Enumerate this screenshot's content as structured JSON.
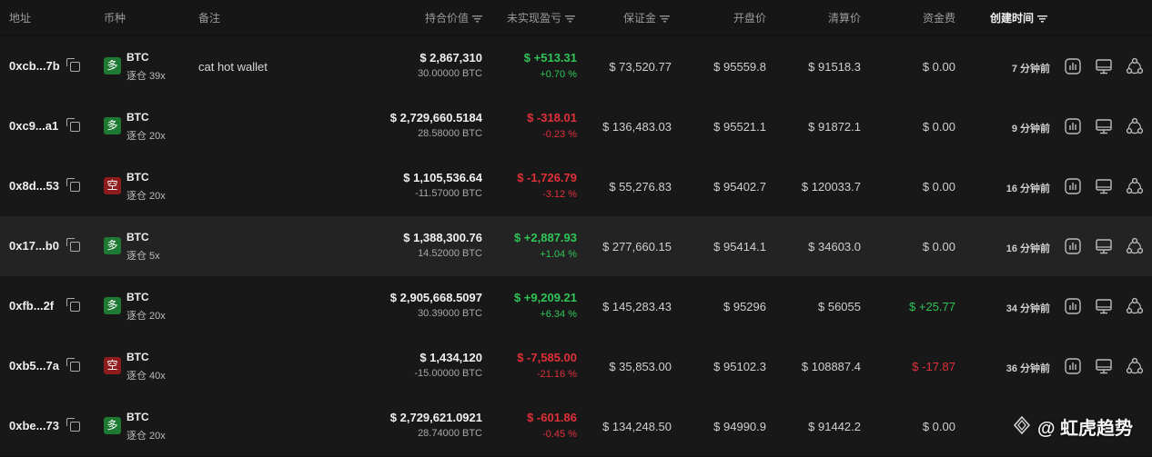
{
  "columns": {
    "address": "地址",
    "coin": "币种",
    "note": "备注",
    "position_value": "持合价值",
    "unrealized_pnl": "未实现盈亏",
    "margin": "保证金",
    "open_price": "开盘价",
    "liq_price": "清算价",
    "funding": "资金费",
    "created": "创建时间"
  },
  "colors": {
    "up": "#2fc558",
    "down": "#e0303a",
    "long_badge": "#1e7a32",
    "short_badge": "#8e1c1c"
  },
  "icons": [
    "copy-icon",
    "chart-icon",
    "monitor-icon",
    "share-icon",
    "filter-icon"
  ],
  "rows": [
    {
      "address": "0xcb...7b",
      "side": "多",
      "coin": "BTC",
      "leverage": "逐仓 39x",
      "note": "cat hot wallet",
      "value": "$ 2,867,310",
      "qty": "30.00000 BTC",
      "pnl": "$ +513.31",
      "pnl_pct": "+0.70 %",
      "margin": "$ 73,520.77",
      "open": "$ 95559.8",
      "liq": "$ 91518.3",
      "funding": "$ 0.00",
      "time": "7 分钟前"
    },
    {
      "address": "0xc9...a1",
      "side": "多",
      "coin": "BTC",
      "leverage": "逐仓 20x",
      "note": "",
      "value": "$ 2,729,660.5184",
      "qty": "28.58000 BTC",
      "pnl": "$ -318.01",
      "pnl_pct": "-0.23 %",
      "margin": "$ 136,483.03",
      "open": "$ 95521.1",
      "liq": "$ 91872.1",
      "funding": "$ 0.00",
      "time": "9 分钟前"
    },
    {
      "address": "0x8d...53",
      "side": "空",
      "coin": "BTC",
      "leverage": "逐仓 20x",
      "note": "",
      "value": "$ 1,105,536.64",
      "qty": "-11.57000 BTC",
      "pnl": "$ -1,726.79",
      "pnl_pct": "-3.12 %",
      "margin": "$ 55,276.83",
      "open": "$ 95402.7",
      "liq": "$ 120033.7",
      "funding": "$ 0.00",
      "time": "16 分钟前"
    },
    {
      "address": "0x17...b0",
      "side": "多",
      "coin": "BTC",
      "leverage": "逐仓 5x",
      "note": "",
      "value": "$ 1,388,300.76",
      "qty": "14.52000 BTC",
      "pnl": "$ +2,887.93",
      "pnl_pct": "+1.04 %",
      "margin": "$ 277,660.15",
      "open": "$ 95414.1",
      "liq": "$ 34603.0",
      "funding": "$ 0.00",
      "time": "16 分钟前"
    },
    {
      "address": "0xfb...2f",
      "side": "多",
      "coin": "BTC",
      "leverage": "逐仓 20x",
      "note": "",
      "value": "$ 2,905,668.5097",
      "qty": "30.39000 BTC",
      "pnl": "$ +9,209.21",
      "pnl_pct": "+6.34 %",
      "margin": "$ 145,283.43",
      "open": "$ 95296",
      "liq": "$ 56055",
      "funding": "$ +25.77",
      "time": "34 分钟前"
    },
    {
      "address": "0xb5...7a",
      "side": "空",
      "coin": "BTC",
      "leverage": "逐仓 40x",
      "note": "",
      "value": "$ 1,434,120",
      "qty": "-15.00000 BTC",
      "pnl": "$ -7,585.00",
      "pnl_pct": "-21.16 %",
      "margin": "$ 35,853.00",
      "open": "$ 95102.3",
      "liq": "$ 108887.4",
      "funding": "$ -17.87",
      "time": "36 分钟前"
    },
    {
      "address": "0xbe...73",
      "side": "多",
      "coin": "BTC",
      "leverage": "逐仓 20x",
      "note": "",
      "value": "$ 2,729,621.0921",
      "qty": "28.74000 BTC",
      "pnl": "$ -601.86",
      "pnl_pct": "-0.45 %",
      "margin": "$ 134,248.50",
      "open": "$ 94990.9",
      "liq": "$ 91442.2",
      "funding": "$ 0.00",
      "time": ""
    }
  ],
  "watermark": "@ 虹虎趋势"
}
